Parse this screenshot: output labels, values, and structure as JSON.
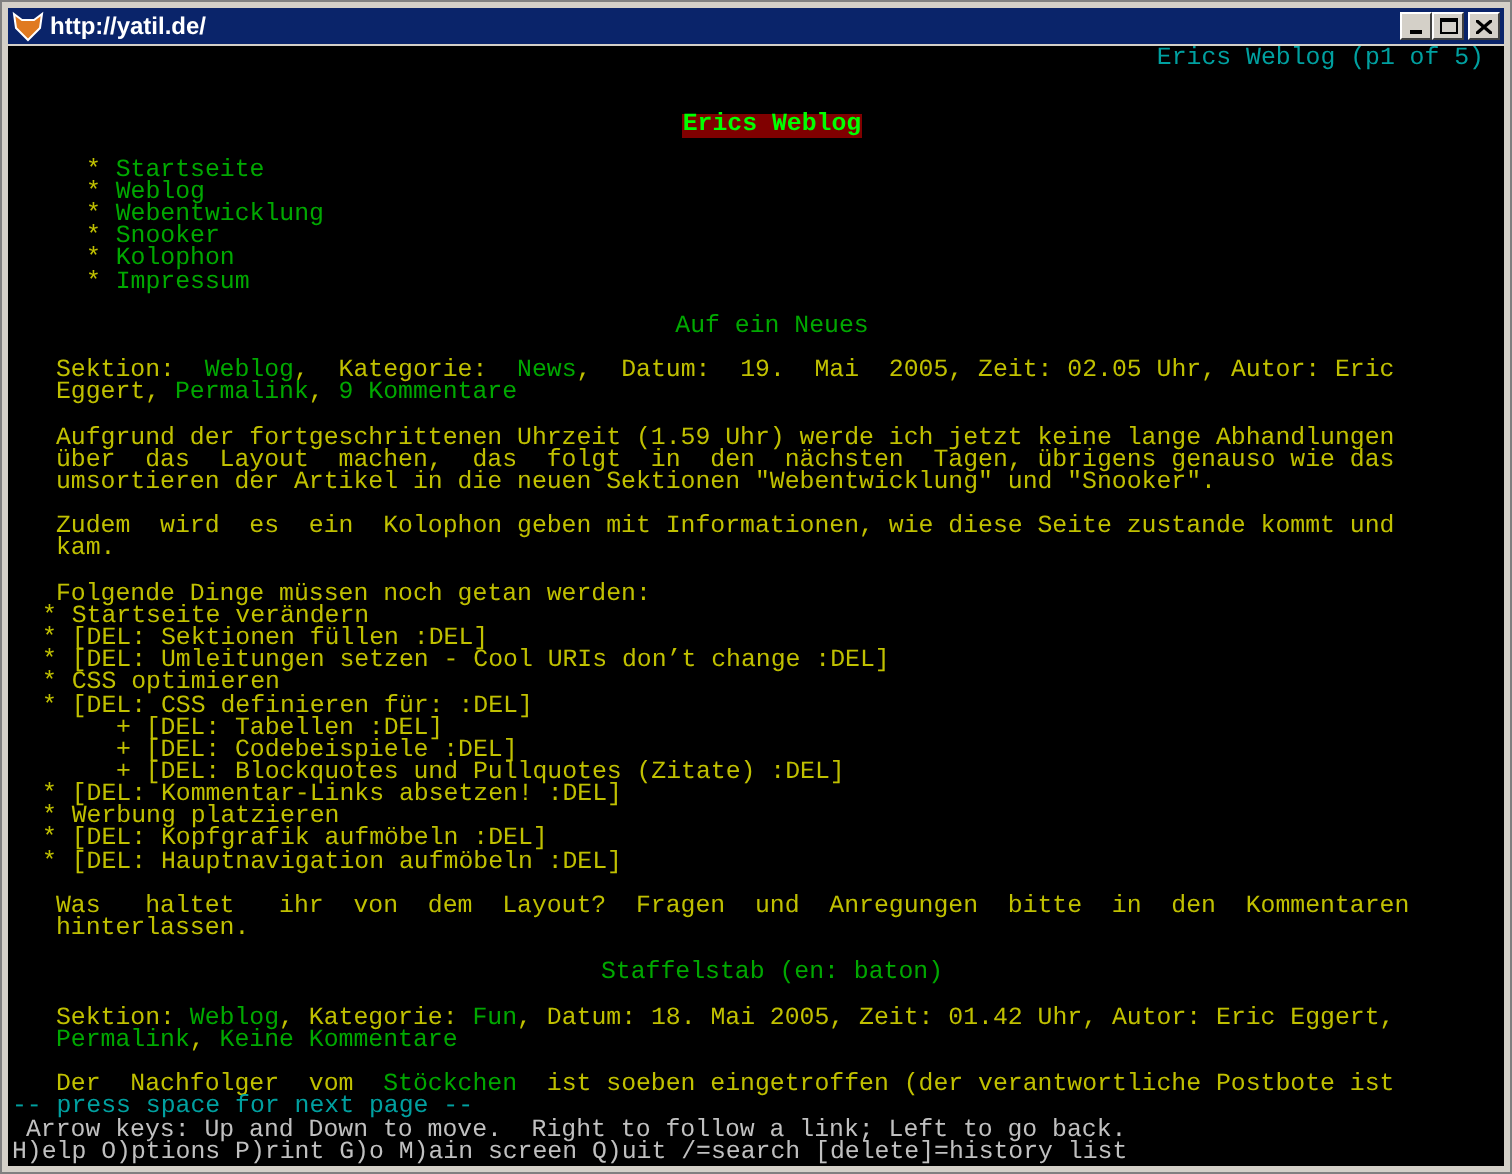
{
  "window": {
    "title": "http://yatil.de/"
  },
  "status_title": "Erics Weblog (p1 of 5)",
  "page_title": "Erics Weblog",
  "nav": [
    {
      "bullet": "*",
      "label": "Startseite"
    },
    {
      "bullet": "*",
      "label": "Weblog"
    },
    {
      "bullet": "*",
      "label": "Webentwicklung"
    },
    {
      "bullet": "*",
      "label": "Snooker"
    },
    {
      "bullet": "*",
      "label": "Kolophon"
    },
    {
      "bullet": "*",
      "label": "Impressum"
    }
  ],
  "blocks": [
    {
      "kind": "heading",
      "text": "Auf ein Neues"
    },
    {
      "kind": "paragraph",
      "lines": [
        [
          {
            "kind": "text",
            "text": "Sektion:  "
          },
          {
            "kind": "link",
            "text": "Weblog"
          },
          {
            "kind": "text",
            "text": ",  Kategorie:  "
          },
          {
            "kind": "link",
            "text": "News"
          },
          {
            "kind": "text",
            "text": ",  Datum:  19.  Mai  2005, Zeit: 02.05 Uhr, Autor: Eric"
          }
        ],
        [
          {
            "kind": "text",
            "text": "Eggert, "
          },
          {
            "kind": "link",
            "text": "Permalink"
          },
          {
            "kind": "text",
            "text": ", "
          },
          {
            "kind": "link",
            "text": "9 Kommentare"
          }
        ]
      ]
    },
    {
      "kind": "paragraph",
      "lines": [
        [
          {
            "kind": "text",
            "text": "Aufgrund der fortgeschrittenen Uhrzeit (1.59 Uhr) werde ich jetzt keine lange Abhandlungen"
          }
        ],
        [
          {
            "kind": "text",
            "text": "über  das  Layout  machen,  das  folgt  in  den  nächsten  Tagen, übrigens genauso wie das"
          }
        ],
        [
          {
            "kind": "text",
            "text": "umsortieren der Artikel in die neuen Sektionen \"Webentwicklung\" und \"Snooker\"."
          }
        ]
      ]
    },
    {
      "kind": "paragraph",
      "lines": [
        [
          {
            "kind": "text",
            "text": "Zudem  wird  es  ein  Kolophon geben mit Informationen, wie diese Seite zustande kommt und"
          }
        ],
        [
          {
            "kind": "text",
            "text": "kam."
          }
        ]
      ]
    },
    {
      "kind": "list",
      "lead": "Folgende Dinge müssen noch getan werden:",
      "items": [
        {
          "bullet": "*",
          "text": "Startseite verändern"
        },
        {
          "bullet": "*",
          "text": "[DEL: Sektionen füllen :DEL]"
        },
        {
          "bullet": "*",
          "text": "[DEL: Umleitungen setzen - Cool URIs don’t change :DEL]"
        },
        {
          "bullet": "*",
          "text": "CSS optimieren"
        },
        {
          "bullet": "*",
          "text": "[DEL: CSS definieren für: :DEL]",
          "children": [
            {
              "bullet": "+",
              "text": "[DEL: Tabellen :DEL]"
            },
            {
              "bullet": "+",
              "text": "[DEL: Codebeispiele :DEL]"
            },
            {
              "bullet": "+",
              "text": "[DEL: Blockquotes und Pullquotes (Zitate) :DEL]"
            }
          ]
        },
        {
          "bullet": "*",
          "text": "[DEL: Kommentar-Links absetzen! :DEL]"
        },
        {
          "bullet": "*",
          "text": "Werbung platzieren"
        },
        {
          "bullet": "*",
          "text": "[DEL: Kopfgrafik aufmöbeln :DEL]"
        },
        {
          "bullet": "*",
          "text": "[DEL: Hauptnavigation aufmöbeln :DEL]"
        }
      ]
    },
    {
      "kind": "paragraph",
      "lines": [
        [
          {
            "kind": "text",
            "text": "Was   haltet   ihr  von  dem  Layout?  Fragen  und  Anregungen  bitte  in  den  Kommentaren"
          }
        ],
        [
          {
            "kind": "text",
            "text": "hinterlassen."
          }
        ]
      ]
    },
    {
      "kind": "heading",
      "text": "Staffelstab (en: baton)"
    },
    {
      "kind": "paragraph",
      "lines": [
        [
          {
            "kind": "text",
            "text": "Sektion: "
          },
          {
            "kind": "link",
            "text": "Weblog"
          },
          {
            "kind": "text",
            "text": ", Kategorie: "
          },
          {
            "kind": "link",
            "text": "Fun"
          },
          {
            "kind": "text",
            "text": ", Datum: 18. Mai 2005, Zeit: 01.42 Uhr, Autor: Eric Eggert,"
          }
        ],
        [
          {
            "kind": "link",
            "text": "Permalink"
          },
          {
            "kind": "text",
            "text": ", "
          },
          {
            "kind": "link",
            "text": "Keine Kommentare"
          }
        ]
      ]
    },
    {
      "kind": "paragraph",
      "lines": [
        [
          {
            "kind": "text",
            "text": "Der  Nachfolger  vom  "
          },
          {
            "kind": "link",
            "text": "Stöckchen"
          },
          {
            "kind": "text",
            "text": "  ist soeben eingetroffen (der verantwortliche Postbote ist"
          }
        ]
      ]
    }
  ],
  "footer": {
    "prompt": "-- press space for next page --",
    "hint": "Arrow keys: Up and Down to move.  Right to follow a link; Left to go back.",
    "commands": "H)elp O)ptions P)rint G)o M)ain screen Q)uit /=search [delete]=history list"
  }
}
